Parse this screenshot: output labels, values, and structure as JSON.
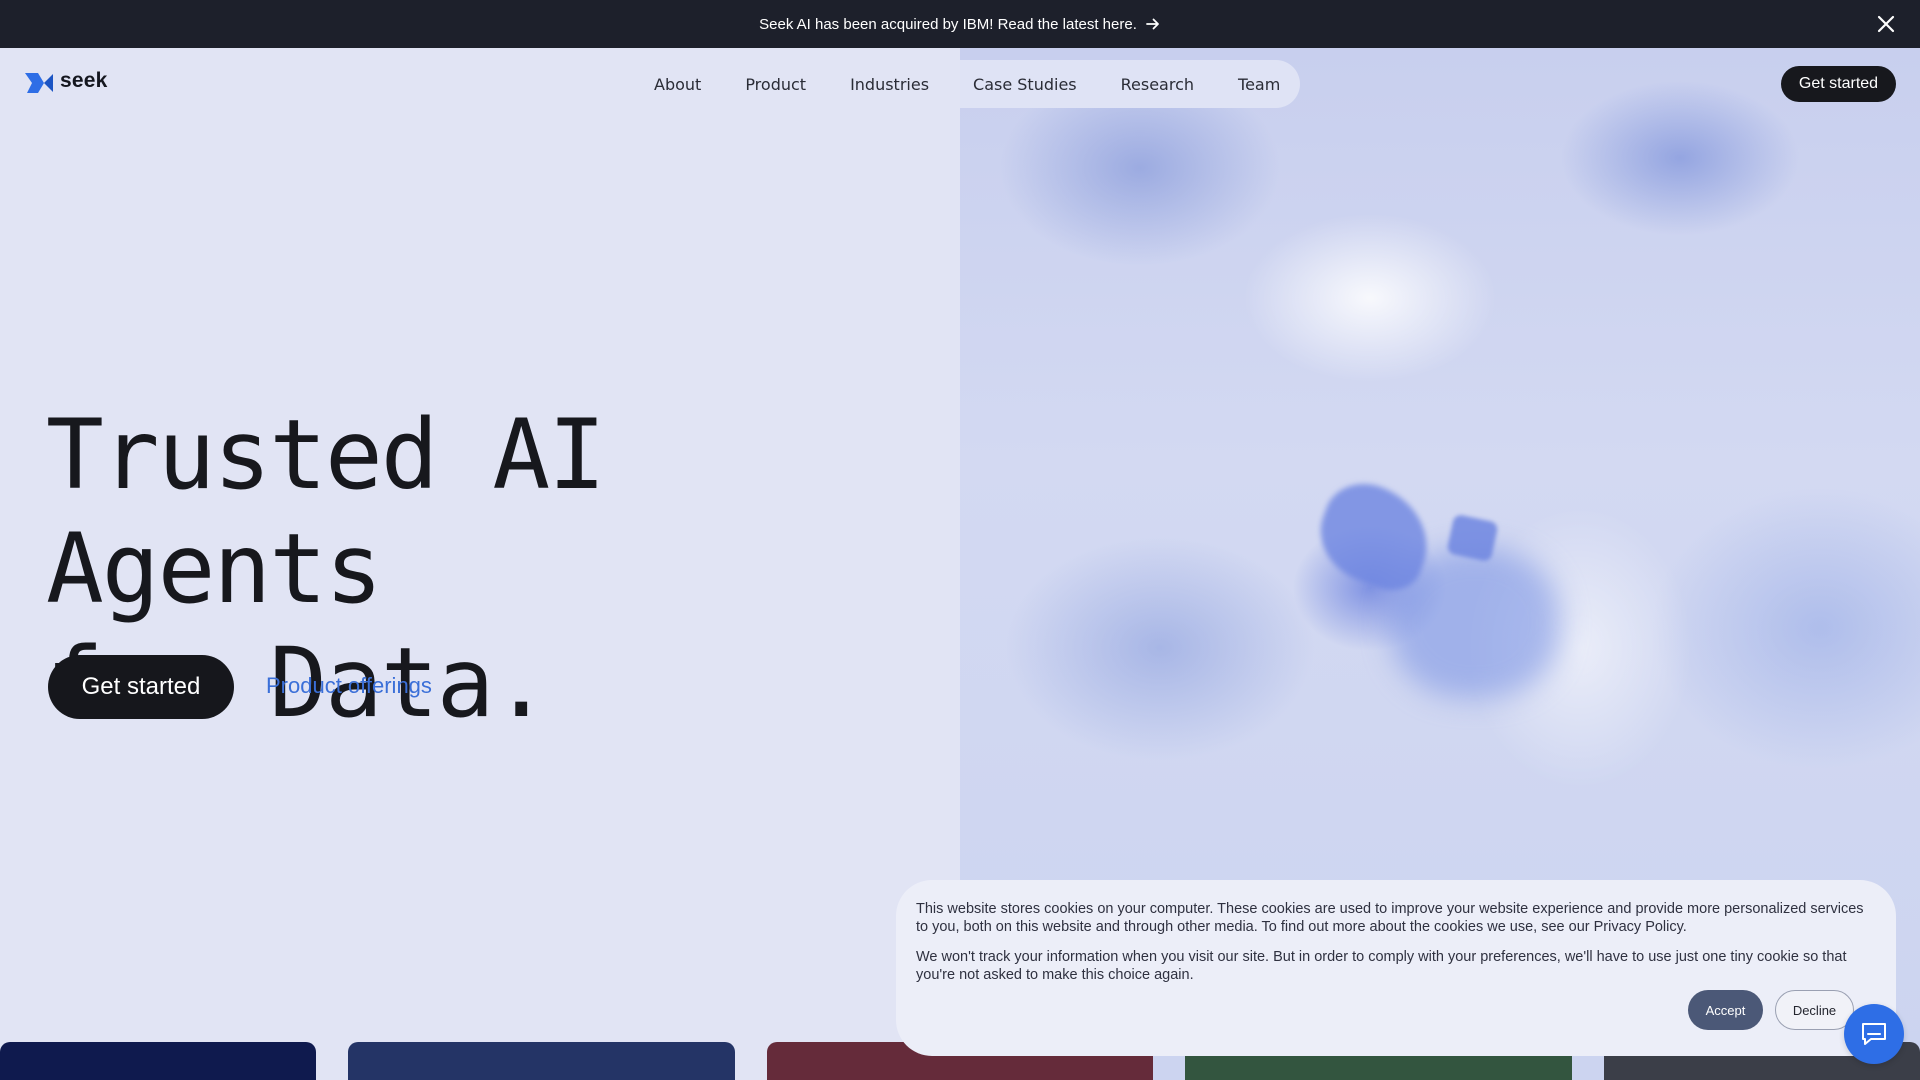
{
  "announcement": {
    "text": "Seek AI has been acquired by IBM! Read the latest here."
  },
  "brand": {
    "name": "seek",
    "accent": "#2e6ee6"
  },
  "nav": {
    "items": [
      "About",
      "Product",
      "Industries",
      "Case Studies",
      "Research",
      "Team"
    ]
  },
  "header": {
    "cta_label": "Get started"
  },
  "hero": {
    "headline_line1": "Trusted AI Agents",
    "headline_line2": "for Data.",
    "cta_label": "Get started",
    "secondary_link": "Product offerings"
  },
  "cards": {
    "colors": [
      "#0f1a4e",
      "#243466",
      "#652b3a",
      "#33553f",
      "#3b3e48"
    ]
  },
  "cookie_banner": {
    "paragraph1": "This website stores cookies on your computer. These cookies are used to improve your website experience and provide more personalized services to you, both on this website and through other media. To find out more about the cookies we use, see our Privacy Policy.",
    "paragraph2": "We won't track your information when you visit our site. But in order to comply with your preferences, we'll have to use just one tiny cookie so that you're not asked to make this choice again.",
    "accept_label": "Accept",
    "decline_label": "Decline"
  },
  "icons": {
    "announcement_arrow": "arrow-right-icon",
    "announcement_close": "close-icon",
    "logo_mark": "seek-logo-icon",
    "chat": "chat-bubble-icon"
  }
}
